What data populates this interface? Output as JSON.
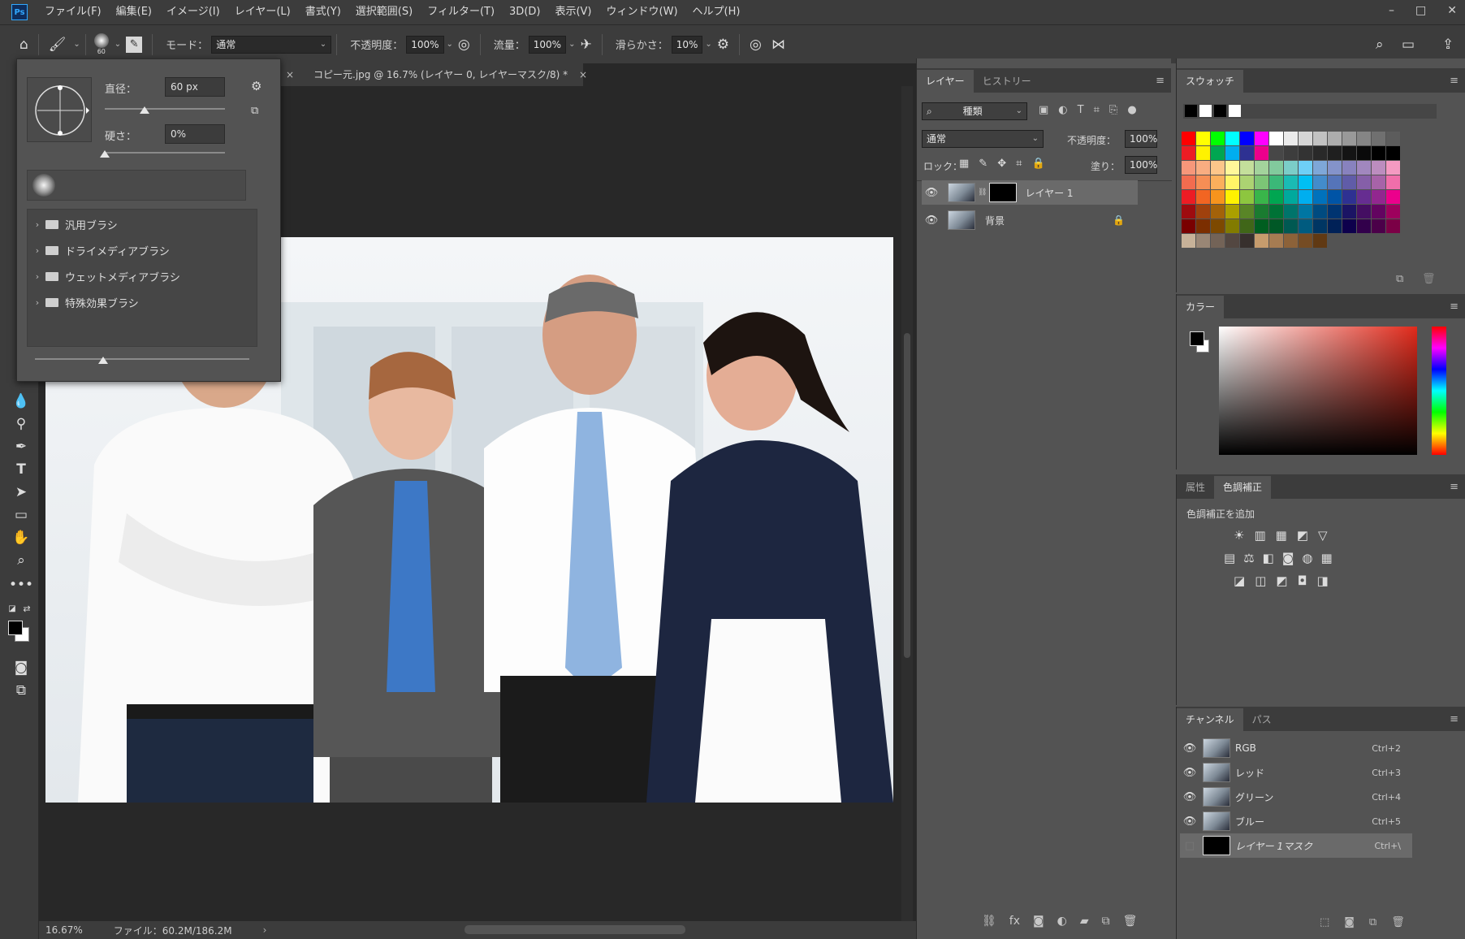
{
  "app": {
    "logo": "Ps"
  },
  "menu": [
    "ファイル(F)",
    "編集(E)",
    "イメージ(I)",
    "レイヤー(L)",
    "書式(Y)",
    "選択範囲(S)",
    "フィルター(T)",
    "3D(D)",
    "表示(V)",
    "ウィンドウ(W)",
    "ヘルプ(H)"
  ],
  "window_controls": [
    "–",
    "□",
    "✕"
  ],
  "options": {
    "brush_size": "60",
    "mode_label": "モード：",
    "mode_value": "通常",
    "opacity_label": "不透明度：",
    "opacity_value": "100%",
    "flow_label": "流量：",
    "flow_value": "100%",
    "smoothing_label": "滑らかさ：",
    "smoothing_value": "10%"
  },
  "document": {
    "tab_title": "コピー元.jpg @ 16.7% (レイヤー 0, レイヤーマスク/8) *",
    "close": "×",
    "zoom": "16.67%",
    "file_info": "ファイル：60.2M/186.2M"
  },
  "brush_popup": {
    "diameter_label": "直径：",
    "diameter_value": "60 px",
    "hardness_label": "硬さ：",
    "hardness_value": "0%",
    "diameter_level": 0.33,
    "hardness_level": 0.0,
    "folders": [
      "汎用ブラシ",
      "ドライメディアブラシ",
      "ウェットメディアブラシ",
      "特殊効果ブラシ"
    ]
  },
  "layers_panel": {
    "tabs": [
      "レイヤー",
      "ヒストリー"
    ],
    "kind_filter": "種類",
    "blend_mode": "通常",
    "opacity_label": "不透明度：",
    "opacity_value": "100%",
    "lock_label": "ロック：",
    "fill_label": "塗り：",
    "fill_value": "100%",
    "layers": [
      {
        "name": "レイヤー 1",
        "has_mask": true,
        "selected": true
      },
      {
        "name": "背景",
        "locked": true
      }
    ]
  },
  "swatches_panel": {
    "tab": "スウォッチ",
    "recent": [
      "#000000",
      "#ffffff",
      "#000000",
      "#ffffff"
    ],
    "grid": [
      [
        "#ff0000",
        "#ffff00",
        "#00ff00",
        "#00ffff",
        "#0000ff",
        "#ff00ff",
        "#ffffff",
        "#ebebeb",
        "#d6d6d6",
        "#c2c2c2",
        "#adadad",
        "#999999",
        "#858585",
        "#707070",
        "#5c5c5c"
      ],
      [
        "#ed1c24",
        "#fff200",
        "#00a651",
        "#00aeef",
        "#2e3192",
        "#ec008c",
        "#474747",
        "#3d3d3d",
        "#333333",
        "#292929",
        "#1f1f1f",
        "#141414",
        "#0a0a0a",
        "#000000",
        "#000000"
      ],
      [
        "#f7977a",
        "#f9ad81",
        "#fdc68a",
        "#fff79a",
        "#c4df9b",
        "#a3d39c",
        "#82ca9d",
        "#7bcdc8",
        "#6ecff6",
        "#7ea7d8",
        "#8493ca",
        "#8882be",
        "#a187be",
        "#bc8dbf",
        "#f49ac2"
      ],
      [
        "#f26c4f",
        "#f68e55",
        "#fbaf5c",
        "#fff467",
        "#acd372",
        "#7cc576",
        "#3bb878",
        "#1abbb4",
        "#00bff3",
        "#438ccb",
        "#5574b9",
        "#605ca8",
        "#855fa8",
        "#a763a8",
        "#f06eaa"
      ],
      [
        "#ed1c24",
        "#f26522",
        "#f7941d",
        "#fff200",
        "#8dc63f",
        "#39b54a",
        "#00a651",
        "#00a99d",
        "#00aeef",
        "#0072bc",
        "#0054a6",
        "#2e3192",
        "#662d91",
        "#92278f",
        "#ec008c"
      ],
      [
        "#9e0b0f",
        "#a0410d",
        "#a36209",
        "#aba000",
        "#598527",
        "#1a7b30",
        "#007236",
        "#00746b",
        "#0076a3",
        "#004b80",
        "#003471",
        "#1b1464",
        "#440e62",
        "#630460",
        "#9e005d"
      ],
      [
        "#790000",
        "#7b2e00",
        "#7d4900",
        "#827b00",
        "#406618",
        "#005e20",
        "#005826",
        "#005952",
        "#005b7f",
        "#003663",
        "#002157",
        "#0d004c",
        "#32004b",
        "#4b0049",
        "#7b0046"
      ],
      [
        "#c7b299",
        "#998675",
        "#736357",
        "#534741",
        "#37302d",
        "#c69c6d",
        "#a67c52",
        "#8c6239",
        "#754c24",
        "#603913"
      ]
    ]
  },
  "color_panel": {
    "tab": "カラー",
    "hue_colors": [
      "#ff0000",
      "#ffff00",
      "#00ff00",
      "#00ffff",
      "#0000ff",
      "#ff00ff",
      "#ff0000"
    ]
  },
  "adjust_panel": {
    "tabs": [
      "属性",
      "色調補正"
    ],
    "add_label": "色調補正を追加",
    "icons_row1": [
      "☀",
      "▥",
      "▦",
      "◩",
      "▽"
    ],
    "icons_row2": [
      "▤",
      "⚖",
      "◧",
      "◙",
      "◍",
      "▦"
    ],
    "icons_row3": [
      "◪",
      "◫",
      "◩",
      "◘",
      "◨"
    ]
  },
  "channels_panel": {
    "tabs": [
      "チャンネル",
      "パス"
    ],
    "channels": [
      {
        "name": "RGB",
        "shortcut": "Ctrl+2"
      },
      {
        "name": "レッド",
        "shortcut": "Ctrl+3"
      },
      {
        "name": "グリーン",
        "shortcut": "Ctrl+4"
      },
      {
        "name": "ブルー",
        "shortcut": "Ctrl+5"
      },
      {
        "name": "レイヤー 1マスク",
        "shortcut": "Ctrl+\\",
        "mask": true
      }
    ]
  }
}
